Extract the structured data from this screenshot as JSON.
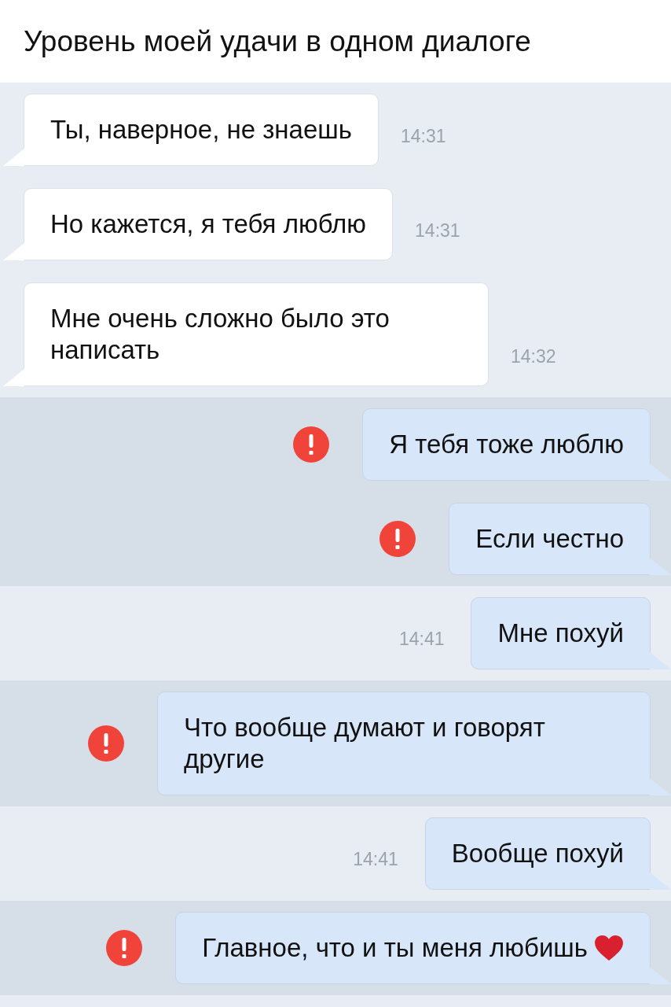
{
  "title": "Уровень моей удачи в одном диалоге",
  "messages": [
    {
      "kind": "incoming",
      "text": "Ты, наверное, не знаешь",
      "time": "14:31",
      "failed": false
    },
    {
      "kind": "incoming",
      "text": "Но кажется, я тебя люблю",
      "time": "14:31",
      "failed": false
    },
    {
      "kind": "incoming",
      "text": "Мне очень сложно было это написать",
      "time": "14:32",
      "failed": false
    },
    {
      "kind": "outgoing",
      "text": "Я тебя тоже люблю",
      "failed": true
    },
    {
      "kind": "outgoing",
      "text": "Если честно",
      "failed": true
    },
    {
      "kind": "outgoing",
      "text": "Мне похуй",
      "time": "14:41",
      "failed": false
    },
    {
      "kind": "outgoing",
      "text": "Что вообще думают и говорят другие",
      "failed": true
    },
    {
      "kind": "outgoing",
      "text": "Вообще похуй",
      "time": "14:41",
      "failed": false
    },
    {
      "kind": "outgoing",
      "text": "Главное, что и ты меня любишь",
      "failed": true,
      "heart": true
    }
  ]
}
